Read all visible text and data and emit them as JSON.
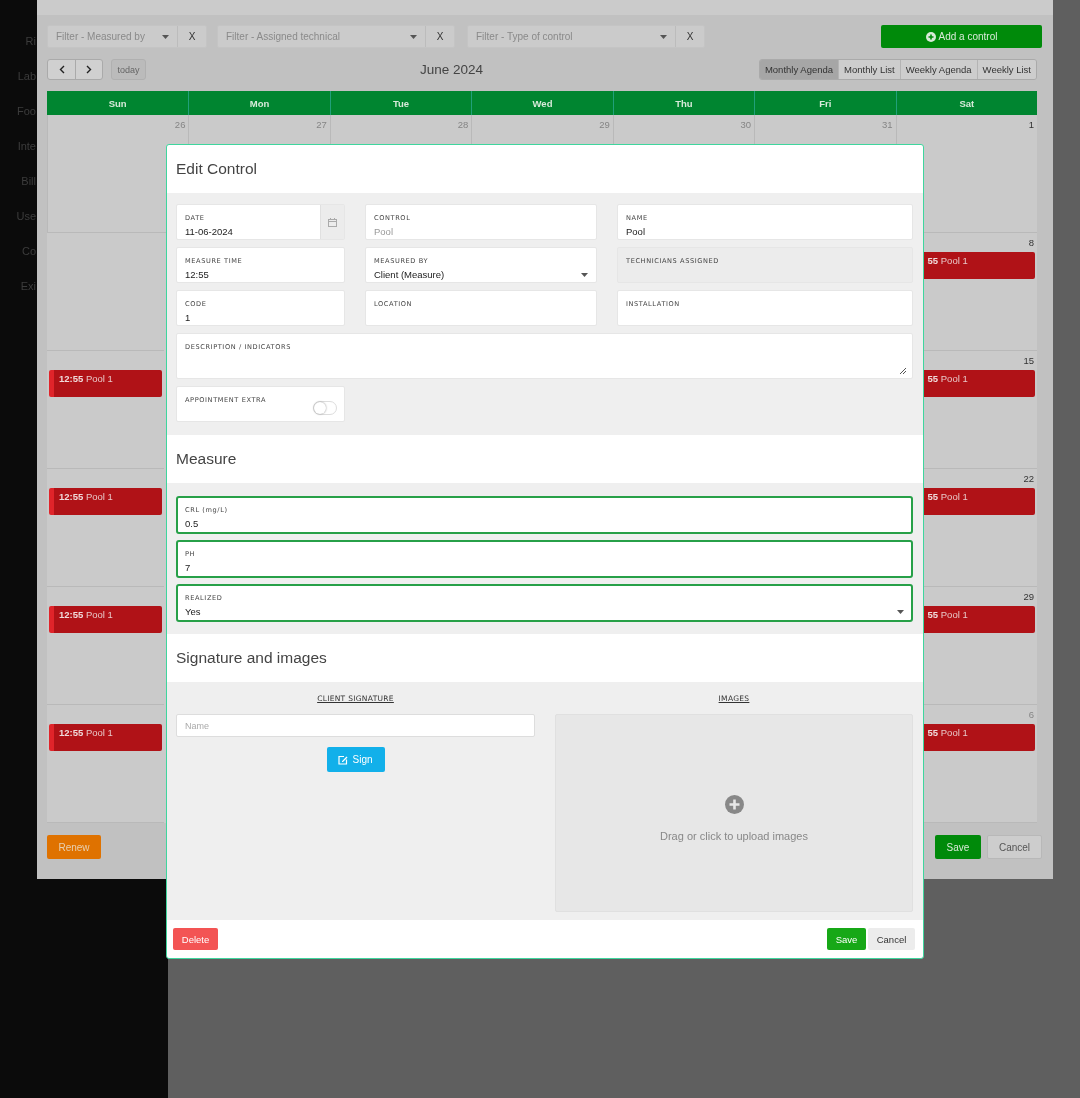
{
  "sidebar": {
    "items": [
      "Ri",
      "Lab",
      "Foo",
      "Inte",
      "Bill",
      "Use",
      "Co",
      "Exi"
    ]
  },
  "planner": {
    "filters": [
      {
        "placeholder": "Filter - Measured by",
        "clear": "X"
      },
      {
        "placeholder": "Filter - Assigned technical",
        "clear": "X"
      },
      {
        "placeholder": "Filter - Type of control",
        "clear": "X"
      }
    ],
    "add_button": "Add a control",
    "today": "today",
    "title": "June 2024",
    "views": [
      {
        "label": "Monthly Agenda",
        "selected": true
      },
      {
        "label": "Monthly List",
        "selected": false
      },
      {
        "label": "Weekly Agenda",
        "selected": false
      },
      {
        "label": "Weekly List",
        "selected": false
      }
    ],
    "weekdays": [
      "Sun",
      "Mon",
      "Tue",
      "Wed",
      "Thu",
      "Fri",
      "Sat"
    ],
    "weeks": [
      {
        "sun": {
          "number": "26",
          "other_month": true
        },
        "mid": [
          {
            "number": "27",
            "other_month": true
          },
          {
            "number": "28",
            "other_month": true
          },
          {
            "number": "29",
            "other_month": true
          },
          {
            "number": "30",
            "other_month": true
          },
          {
            "number": "31",
            "other_month": true
          }
        ],
        "sat": {
          "number": "1",
          "other_month": false
        }
      },
      {
        "sat": {
          "number": "8",
          "other_month": false,
          "events": [
            {
              "time": "55",
              "title": "Pool 1"
            }
          ]
        }
      },
      {
        "sun": {
          "events": [
            {
              "time": "12:55",
              "title": "Pool 1"
            }
          ]
        },
        "sat": {
          "number": "15",
          "other_month": false,
          "events": [
            {
              "time": "55",
              "title": "Pool 1"
            }
          ]
        }
      },
      {
        "sun": {
          "events": [
            {
              "time": "12:55",
              "title": "Pool 1"
            }
          ]
        },
        "sat": {
          "number": "22",
          "other_month": false,
          "events": [
            {
              "time": "55",
              "title": "Pool 1"
            }
          ]
        }
      },
      {
        "sun": {
          "events": [
            {
              "time": "12:55",
              "title": "Pool 1"
            }
          ]
        },
        "sat": {
          "number": "29",
          "other_month": false,
          "events": [
            {
              "time": "55",
              "title": "Pool 1"
            }
          ]
        }
      },
      {
        "sun": {
          "events": [
            {
              "time": "12:55",
              "title": "Pool 1"
            }
          ]
        },
        "sat": {
          "number": "6",
          "other_month": true,
          "events": [
            {
              "time": "55",
              "title": "Pool 1"
            }
          ]
        }
      }
    ],
    "footer": {
      "renew": "Renew",
      "save": "Save",
      "cancel": "Cancel"
    }
  },
  "modal": {
    "title": "Edit Control",
    "rows": [
      [
        {
          "kind": "date",
          "label": "DATE",
          "value": "11-06-2024",
          "disabled": false
        },
        {
          "kind": "input",
          "label": "CONTROL",
          "placeholder": "Pool",
          "disabled": false
        },
        {
          "kind": "input",
          "label": "NAME",
          "value": "Pool",
          "disabled": false
        }
      ],
      [
        {
          "kind": "input",
          "label": "MEASURE TIME",
          "value": "12:55",
          "disabled": false
        },
        {
          "kind": "select",
          "label": "MEASURED BY",
          "value": "Client (Measure)",
          "disabled": false
        },
        {
          "kind": "input",
          "label": "TECHNICIANS ASSIGNED",
          "disabled": true
        }
      ],
      [
        {
          "kind": "input",
          "label": "CODE",
          "value": "1",
          "disabled": false
        },
        {
          "kind": "input",
          "label": "LOCATION",
          "disabled": false
        },
        {
          "kind": "input",
          "label": "INSTALLATION",
          "disabled": false
        }
      ],
      [
        {
          "kind": "textarea",
          "label": "DESCRIPTION / INDICATORS",
          "disabled": false
        }
      ],
      [
        {
          "kind": "toggle",
          "label": "APPOINTMENT EXTRA",
          "on": false,
          "disabled": false
        }
      ]
    ],
    "measure": {
      "title": "Measure",
      "fields": [
        {
          "kind": "input",
          "label": "CRL (mg/L)",
          "value": "0.5",
          "valid": true
        },
        {
          "kind": "input",
          "label": "PH",
          "value": "7",
          "valid": true
        },
        {
          "kind": "select",
          "label": "REALIZED",
          "value": "Yes",
          "valid": true
        }
      ]
    },
    "signature": {
      "title": "Signature and images",
      "client_heading": "CLIENT SIGNATURE",
      "name_placeholder": "Name",
      "sign_button": "Sign",
      "images_heading": "IMAGES",
      "dropzone_text": "Drag or click to upload images"
    },
    "footer": {
      "delete": "Delete",
      "save": "Save",
      "cancel": "Cancel"
    }
  }
}
